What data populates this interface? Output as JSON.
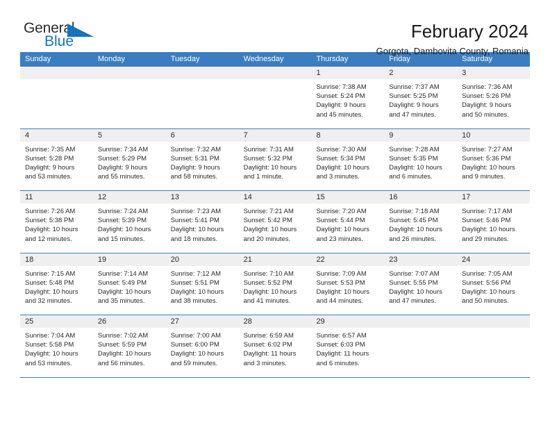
{
  "brand": {
    "name_top": "General",
    "name_bottom": "Blue",
    "triangle_icon": "triangle-icon",
    "accent_color": "#1673bd"
  },
  "header": {
    "title": "February 2024",
    "subtitle": "Gorgota, Dambovita County, Romania"
  },
  "calendar": {
    "header_bg": "#3b7dc0",
    "day_band_bg": "#efefef",
    "weekdays": [
      "Sunday",
      "Monday",
      "Tuesday",
      "Wednesday",
      "Thursday",
      "Friday",
      "Saturday"
    ],
    "weeks": [
      [
        {
          "day": "",
          "sunrise": "",
          "sunset": "",
          "daylight1": "",
          "daylight2": ""
        },
        {
          "day": "",
          "sunrise": "",
          "sunset": "",
          "daylight1": "",
          "daylight2": ""
        },
        {
          "day": "",
          "sunrise": "",
          "sunset": "",
          "daylight1": "",
          "daylight2": ""
        },
        {
          "day": "",
          "sunrise": "",
          "sunset": "",
          "daylight1": "",
          "daylight2": ""
        },
        {
          "day": "1",
          "sunrise": "Sunrise: 7:38 AM",
          "sunset": "Sunset: 5:24 PM",
          "daylight1": "Daylight: 9 hours",
          "daylight2": "and 45 minutes."
        },
        {
          "day": "2",
          "sunrise": "Sunrise: 7:37 AM",
          "sunset": "Sunset: 5:25 PM",
          "daylight1": "Daylight: 9 hours",
          "daylight2": "and 47 minutes."
        },
        {
          "day": "3",
          "sunrise": "Sunrise: 7:36 AM",
          "sunset": "Sunset: 5:26 PM",
          "daylight1": "Daylight: 9 hours",
          "daylight2": "and 50 minutes."
        }
      ],
      [
        {
          "day": "4",
          "sunrise": "Sunrise: 7:35 AM",
          "sunset": "Sunset: 5:28 PM",
          "daylight1": "Daylight: 9 hours",
          "daylight2": "and 53 minutes."
        },
        {
          "day": "5",
          "sunrise": "Sunrise: 7:34 AM",
          "sunset": "Sunset: 5:29 PM",
          "daylight1": "Daylight: 9 hours",
          "daylight2": "and 55 minutes."
        },
        {
          "day": "6",
          "sunrise": "Sunrise: 7:32 AM",
          "sunset": "Sunset: 5:31 PM",
          "daylight1": "Daylight: 9 hours",
          "daylight2": "and 58 minutes."
        },
        {
          "day": "7",
          "sunrise": "Sunrise: 7:31 AM",
          "sunset": "Sunset: 5:32 PM",
          "daylight1": "Daylight: 10 hours",
          "daylight2": "and 1 minute."
        },
        {
          "day": "8",
          "sunrise": "Sunrise: 7:30 AM",
          "sunset": "Sunset: 5:34 PM",
          "daylight1": "Daylight: 10 hours",
          "daylight2": "and 3 minutes."
        },
        {
          "day": "9",
          "sunrise": "Sunrise: 7:28 AM",
          "sunset": "Sunset: 5:35 PM",
          "daylight1": "Daylight: 10 hours",
          "daylight2": "and 6 minutes."
        },
        {
          "day": "10",
          "sunrise": "Sunrise: 7:27 AM",
          "sunset": "Sunset: 5:36 PM",
          "daylight1": "Daylight: 10 hours",
          "daylight2": "and 9 minutes."
        }
      ],
      [
        {
          "day": "11",
          "sunrise": "Sunrise: 7:26 AM",
          "sunset": "Sunset: 5:38 PM",
          "daylight1": "Daylight: 10 hours",
          "daylight2": "and 12 minutes."
        },
        {
          "day": "12",
          "sunrise": "Sunrise: 7:24 AM",
          "sunset": "Sunset: 5:39 PM",
          "daylight1": "Daylight: 10 hours",
          "daylight2": "and 15 minutes."
        },
        {
          "day": "13",
          "sunrise": "Sunrise: 7:23 AM",
          "sunset": "Sunset: 5:41 PM",
          "daylight1": "Daylight: 10 hours",
          "daylight2": "and 18 minutes."
        },
        {
          "day": "14",
          "sunrise": "Sunrise: 7:21 AM",
          "sunset": "Sunset: 5:42 PM",
          "daylight1": "Daylight: 10 hours",
          "daylight2": "and 20 minutes."
        },
        {
          "day": "15",
          "sunrise": "Sunrise: 7:20 AM",
          "sunset": "Sunset: 5:44 PM",
          "daylight1": "Daylight: 10 hours",
          "daylight2": "and 23 minutes."
        },
        {
          "day": "16",
          "sunrise": "Sunrise: 7:18 AM",
          "sunset": "Sunset: 5:45 PM",
          "daylight1": "Daylight: 10 hours",
          "daylight2": "and 26 minutes."
        },
        {
          "day": "17",
          "sunrise": "Sunrise: 7:17 AM",
          "sunset": "Sunset: 5:46 PM",
          "daylight1": "Daylight: 10 hours",
          "daylight2": "and 29 minutes."
        }
      ],
      [
        {
          "day": "18",
          "sunrise": "Sunrise: 7:15 AM",
          "sunset": "Sunset: 5:48 PM",
          "daylight1": "Daylight: 10 hours",
          "daylight2": "and 32 minutes."
        },
        {
          "day": "19",
          "sunrise": "Sunrise: 7:14 AM",
          "sunset": "Sunset: 5:49 PM",
          "daylight1": "Daylight: 10 hours",
          "daylight2": "and 35 minutes."
        },
        {
          "day": "20",
          "sunrise": "Sunrise: 7:12 AM",
          "sunset": "Sunset: 5:51 PM",
          "daylight1": "Daylight: 10 hours",
          "daylight2": "and 38 minutes."
        },
        {
          "day": "21",
          "sunrise": "Sunrise: 7:10 AM",
          "sunset": "Sunset: 5:52 PM",
          "daylight1": "Daylight: 10 hours",
          "daylight2": "and 41 minutes."
        },
        {
          "day": "22",
          "sunrise": "Sunrise: 7:09 AM",
          "sunset": "Sunset: 5:53 PM",
          "daylight1": "Daylight: 10 hours",
          "daylight2": "and 44 minutes."
        },
        {
          "day": "23",
          "sunrise": "Sunrise: 7:07 AM",
          "sunset": "Sunset: 5:55 PM",
          "daylight1": "Daylight: 10 hours",
          "daylight2": "and 47 minutes."
        },
        {
          "day": "24",
          "sunrise": "Sunrise: 7:05 AM",
          "sunset": "Sunset: 5:56 PM",
          "daylight1": "Daylight: 10 hours",
          "daylight2": "and 50 minutes."
        }
      ],
      [
        {
          "day": "25",
          "sunrise": "Sunrise: 7:04 AM",
          "sunset": "Sunset: 5:58 PM",
          "daylight1": "Daylight: 10 hours",
          "daylight2": "and 53 minutes."
        },
        {
          "day": "26",
          "sunrise": "Sunrise: 7:02 AM",
          "sunset": "Sunset: 5:59 PM",
          "daylight1": "Daylight: 10 hours",
          "daylight2": "and 56 minutes."
        },
        {
          "day": "27",
          "sunrise": "Sunrise: 7:00 AM",
          "sunset": "Sunset: 6:00 PM",
          "daylight1": "Daylight: 10 hours",
          "daylight2": "and 59 minutes."
        },
        {
          "day": "28",
          "sunrise": "Sunrise: 6:59 AM",
          "sunset": "Sunset: 6:02 PM",
          "daylight1": "Daylight: 11 hours",
          "daylight2": "and 3 minutes."
        },
        {
          "day": "29",
          "sunrise": "Sunrise: 6:57 AM",
          "sunset": "Sunset: 6:03 PM",
          "daylight1": "Daylight: 11 hours",
          "daylight2": "and 6 minutes."
        },
        {
          "day": "",
          "sunrise": "",
          "sunset": "",
          "daylight1": "",
          "daylight2": ""
        },
        {
          "day": "",
          "sunrise": "",
          "sunset": "",
          "daylight1": "",
          "daylight2": ""
        }
      ]
    ]
  }
}
